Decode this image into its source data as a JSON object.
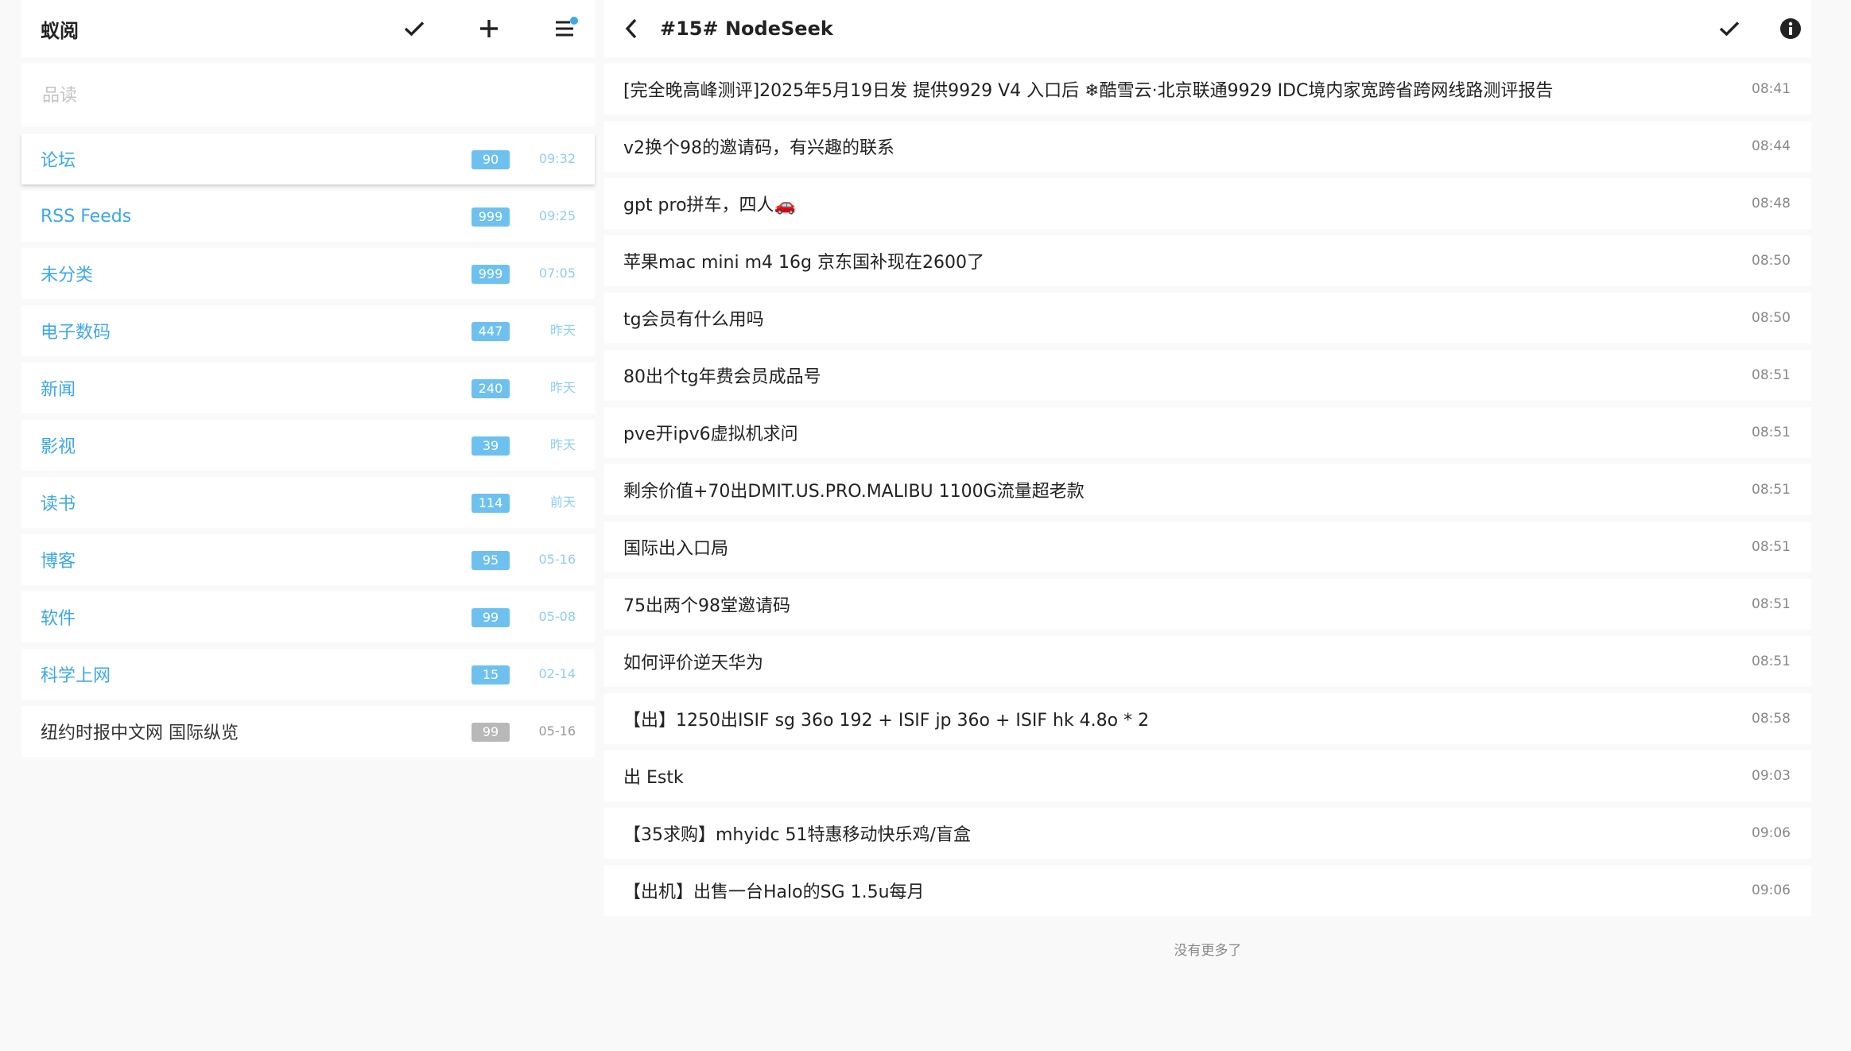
{
  "sidebar": {
    "title": "蚁阅",
    "search_placeholder": "品读",
    "categories": [
      {
        "name": "论坛",
        "count": "90",
        "time": "09:32"
      },
      {
        "name": "RSS Feeds",
        "count": "999",
        "time": "09:25"
      },
      {
        "name": "未分类",
        "count": "999",
        "time": "07:05"
      },
      {
        "name": "电子数码",
        "count": "447",
        "time": "昨天"
      },
      {
        "name": "新闻",
        "count": "240",
        "time": "昨天"
      },
      {
        "name": "影视",
        "count": "39",
        "time": "昨天"
      },
      {
        "name": "读书",
        "count": "114",
        "time": "前天"
      },
      {
        "name": "博客",
        "count": "95",
        "time": "05-16"
      },
      {
        "name": "软件",
        "count": "99",
        "time": "05-08"
      },
      {
        "name": "科学上网",
        "count": "15",
        "time": "02-14"
      },
      {
        "name": "纽约时报中文网 国际纵览",
        "count": "99",
        "time": "05-16"
      }
    ]
  },
  "feed": {
    "title": "#15# NodeSeek",
    "articles": [
      {
        "title": "[完全晚高峰测评]2025年5月19日发 提供9929 V4 入口后 ❄酷雪云·北京联通9929 IDC境内家宽跨省跨网线路测评报告",
        "time": "08:41"
      },
      {
        "title": "v2换个98的邀请码，有兴趣的联系",
        "time": "08:44"
      },
      {
        "title": "gpt pro拼车，四人🚗",
        "time": "08:48"
      },
      {
        "title": "苹果mac mini m4 16g 京东国补现在2600了",
        "time": "08:50"
      },
      {
        "title": "tg会员有什么用吗",
        "time": "08:50"
      },
      {
        "title": "80出个tg年费会员成品号",
        "time": "08:51"
      },
      {
        "title": "pve开ipv6虚拟机求问",
        "time": "08:51"
      },
      {
        "title": "剩余价值+70出DMIT.US.PRO.MALIBU 1100G流量超老款",
        "time": "08:51"
      },
      {
        "title": "国际出入口局",
        "time": "08:51"
      },
      {
        "title": "75出两个98堂邀请码",
        "time": "08:51"
      },
      {
        "title": "如何评价逆天华为",
        "time": "08:51"
      },
      {
        "title": "【出】1250出ISIF sg 36o 192 + ISIF jp 36o + ISIF hk 4.8o * 2",
        "time": "08:58"
      },
      {
        "title": "出 Estk",
        "time": "09:03"
      },
      {
        "title": "【35求购】mhyidc 51特惠移动快乐鸡/盲盒",
        "time": "09:06"
      },
      {
        "title": "【出机】出售一台Halo的SG 1.5u每月",
        "time": "09:06"
      }
    ],
    "no_more_text": "没有更多了"
  },
  "colors": {
    "accent": "#3ea7e8",
    "badge": "#6ec1ef",
    "badge_muted": "#b8b8b8",
    "background": "#f9f9f9"
  },
  "icons": {
    "left_toolbar": [
      "check-icon",
      "plus-icon",
      "menu-icon"
    ],
    "right_toolbar": [
      "back-icon",
      "check-icon",
      "info-icon"
    ]
  }
}
